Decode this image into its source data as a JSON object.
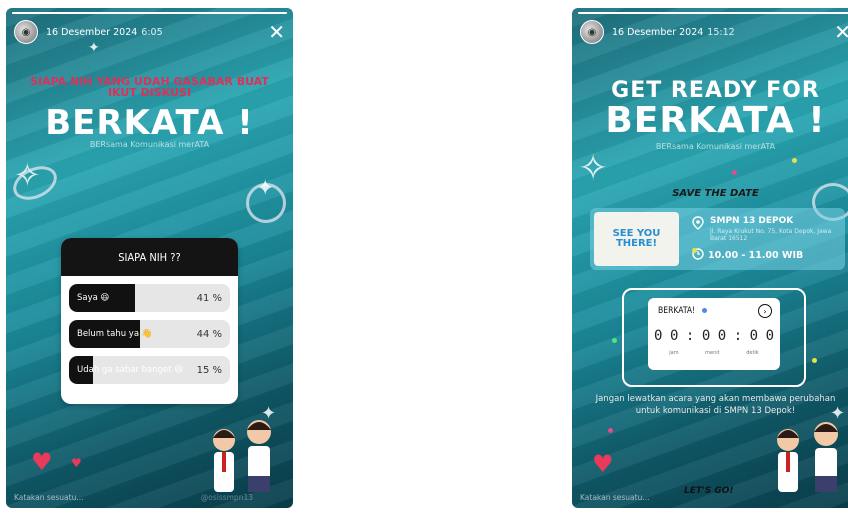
{
  "left_story": {
    "date": "16 Desember 2024",
    "time": "6:05",
    "headline_small": "SIAPA NIH YANG UDAH GASABAR BUAT IKUT DISKUSI",
    "big_title": "BERKATA !",
    "subtitle": "BERsama Komunikasi merATA",
    "poll": {
      "question": "SIAPA NIH ??",
      "options": [
        {
          "label": "Saya 😆",
          "percent_text": "41 %",
          "percent": 41
        },
        {
          "label": "Belum tahu ya 👋",
          "percent_text": "44 %",
          "percent": 44
        },
        {
          "label": "Udah ga sabar banget 😆",
          "percent_text": "15 %",
          "percent": 15
        }
      ]
    },
    "comment_placeholder": "Katakan sesuatu...",
    "footer_handle": "@osissmpn13"
  },
  "right_story": {
    "date": "16 Desember 2024",
    "time": "15:12",
    "headline": "GET READY FOR",
    "big_title": "BERKATA !",
    "subtitle": "BERsama Komunikasi merATA",
    "save_the_date": "SAVE THE DATE",
    "see_you": [
      "SEE YOU",
      "THERE!"
    ],
    "location": "SMPN 13 DEPOK",
    "address": "Jl. Raya Krukut No. 75, Kota Depok, Jawa Barat 16512",
    "time_range": "10.00 - 11.00 WIB",
    "countdown": {
      "title": "BERKATA!",
      "digits": [
        "0",
        "0",
        ":",
        "0",
        "0",
        ":",
        "0",
        "0"
      ],
      "units": [
        "jam",
        "menit",
        "detik"
      ]
    },
    "note": "Jangan lewatkan acara yang akan membawa perubahan untuk komunikasi di SMPN 13 Depok!",
    "lets_go": "LET'S GO!",
    "comment_placeholder": "Katakan sesuatu..."
  },
  "colors": {
    "accent_pink": "#e0305a",
    "teal": "#1f8a9a",
    "white": "#ffffff"
  }
}
